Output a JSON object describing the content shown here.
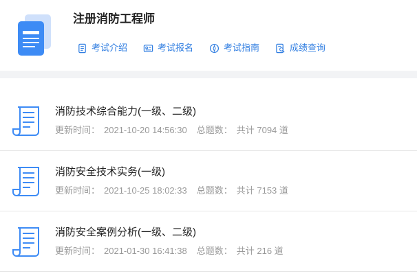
{
  "header": {
    "title": "注册消防工程师",
    "nav": [
      {
        "label": "考试介绍",
        "icon": "document-list-icon"
      },
      {
        "label": "考试报名",
        "icon": "id-card-icon"
      },
      {
        "label": "考试指南",
        "icon": "compass-icon"
      },
      {
        "label": "成绩查询",
        "icon": "search-document-icon"
      }
    ]
  },
  "colors": {
    "accent": "#2f7de1",
    "divider": "#e6e6e6",
    "band": "#f2f3f5"
  },
  "list": {
    "items": [
      {
        "name": "消防技术综合能力(一级、二级)",
        "time_label": "更新时间：",
        "time": "2021-10-20 14:56:30",
        "count_label": "总题数：",
        "count": "共计 7094 道"
      },
      {
        "name": "消防安全技术实务(一级)",
        "time_label": "更新时间：",
        "time": "2021-10-25 18:02:33",
        "count_label": "总题数：",
        "count": "共计 7153 道"
      },
      {
        "name": "消防安全案例分析(一级、二级)",
        "time_label": "更新时间：",
        "time": "2021-01-30 16:41:38",
        "count_label": "总题数：",
        "count": "共计 216 道"
      }
    ]
  }
}
